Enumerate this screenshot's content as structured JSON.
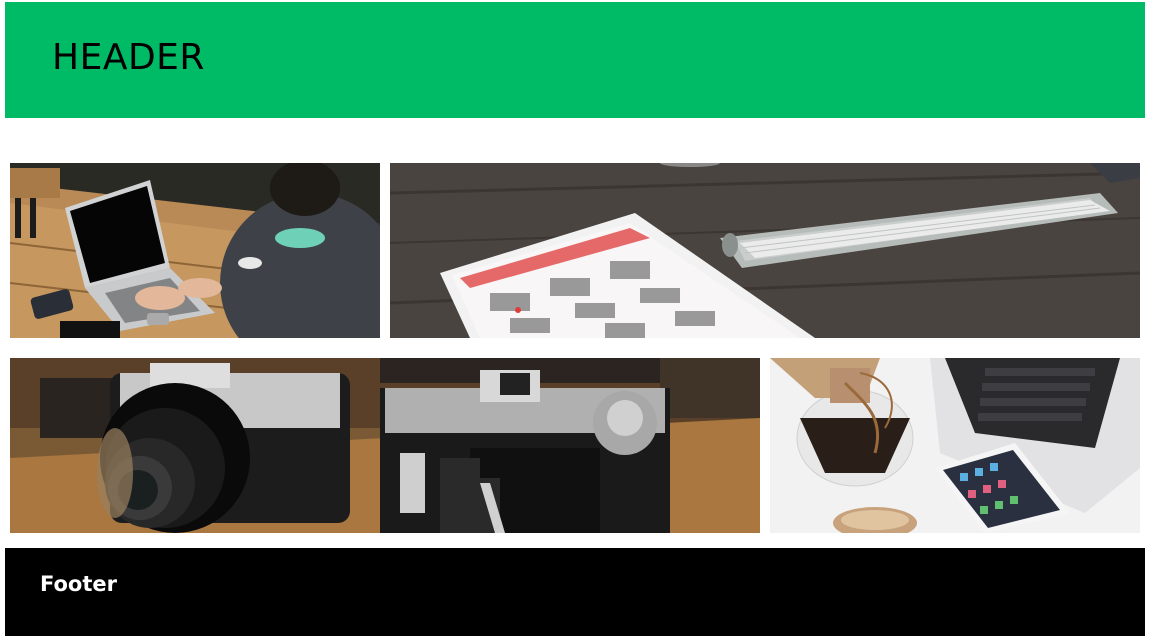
{
  "header": {
    "title": "HEADER"
  },
  "gallery": {
    "images": [
      {
        "subject": "person-typing-on-laptop"
      },
      {
        "subject": "tablet-calendar-and-keyboard"
      },
      {
        "subject": "vintage-cameras"
      },
      {
        "subject": "coffee-phone-and-laptop"
      }
    ]
  },
  "footer": {
    "text": "Footer"
  },
  "colors": {
    "header_bg": "#00bb66",
    "footer_bg": "#000000",
    "footer_text": "#ffffff",
    "page_bg": "#ffffff"
  }
}
